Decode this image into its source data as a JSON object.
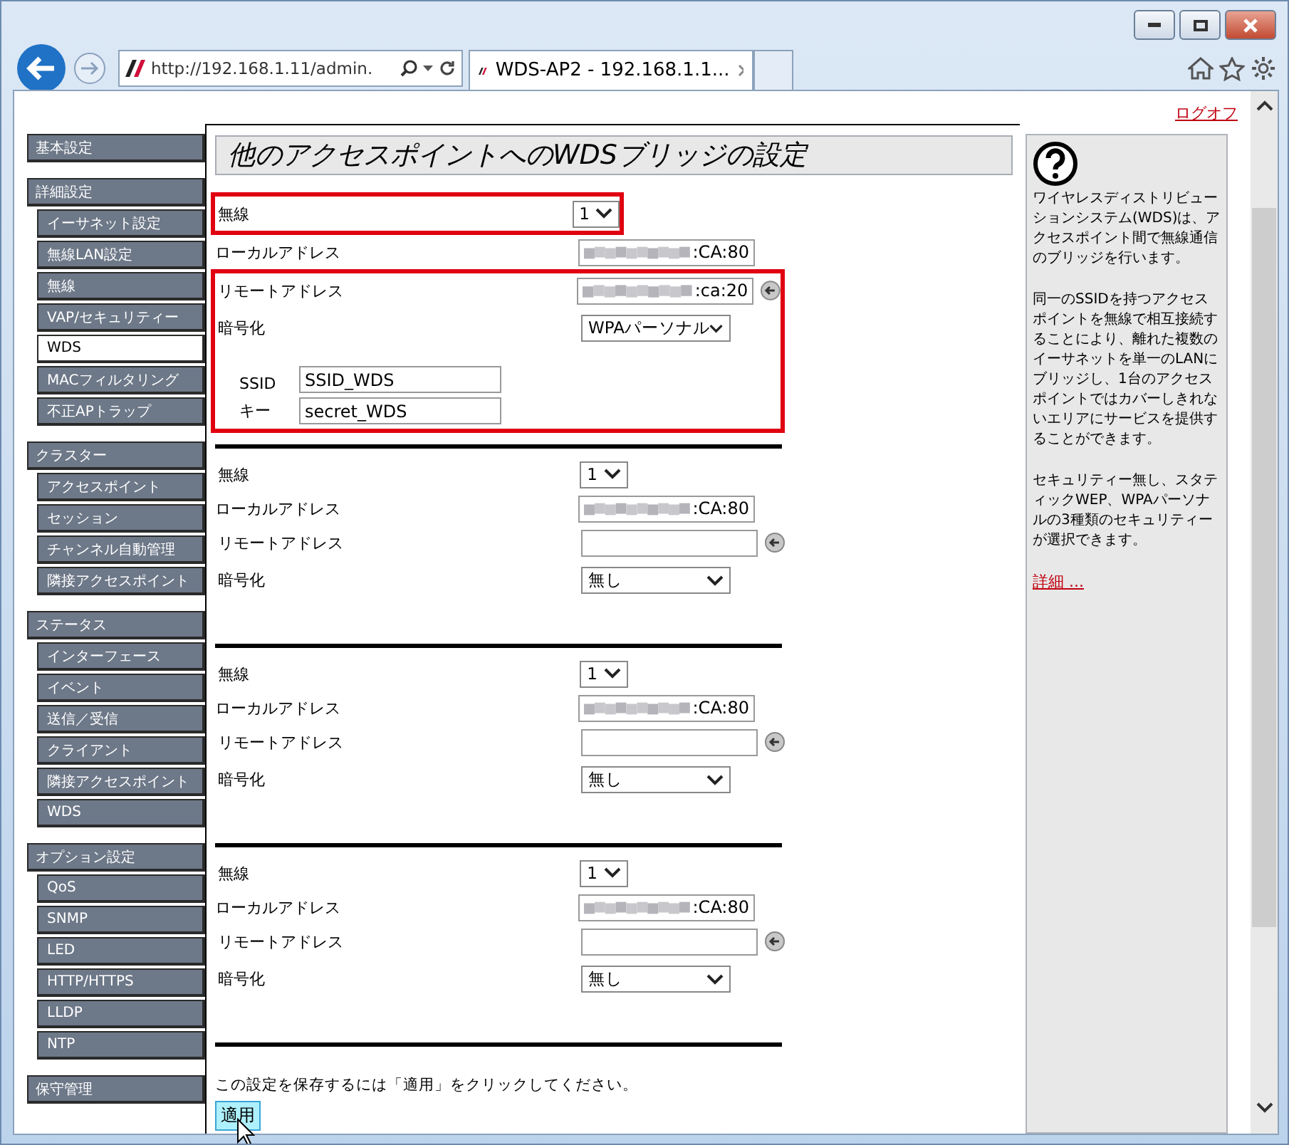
{
  "browser": {
    "address": "http://192.168.1.11/admin.",
    "tab_title": "WDS-AP2 - 192.168.1.1..."
  },
  "logoff": "ログオフ",
  "sidebar": {
    "groups": [
      {
        "label": "基本設定"
      },
      {
        "label": "詳細設定",
        "children": [
          {
            "label": "イーサネット設定",
            "selected": false
          },
          {
            "label": "無線LAN設定",
            "selected": false
          },
          {
            "label": "無線",
            "selected": false
          },
          {
            "label": "VAP/セキュリティー",
            "selected": false
          },
          {
            "label": "WDS",
            "selected": true
          },
          {
            "label": "MACフィルタリング",
            "selected": false
          },
          {
            "label": "不正APトラップ",
            "selected": false
          }
        ]
      },
      {
        "label": "クラスター",
        "children": [
          {
            "label": "アクセスポイント",
            "selected": false
          },
          {
            "label": "セッション",
            "selected": false
          },
          {
            "label": "チャンネル自動管理",
            "selected": false
          },
          {
            "label": "隣接アクセスポイント",
            "selected": false
          }
        ]
      },
      {
        "label": "ステータス",
        "children": [
          {
            "label": "インターフェース",
            "selected": false
          },
          {
            "label": "イベント",
            "selected": false
          },
          {
            "label": "送信／受信",
            "selected": false
          },
          {
            "label": "クライアント",
            "selected": false
          },
          {
            "label": "隣接アクセスポイント",
            "selected": false
          },
          {
            "label": "WDS",
            "selected": false
          }
        ]
      },
      {
        "label": "オプション設定",
        "children": [
          {
            "label": "QoS",
            "selected": false
          },
          {
            "label": "SNMP",
            "selected": false
          },
          {
            "label": "LED",
            "selected": false
          },
          {
            "label": "HTTP/HTTPS",
            "selected": false
          },
          {
            "label": "LLDP",
            "selected": false
          },
          {
            "label": "NTP",
            "selected": false
          }
        ]
      },
      {
        "label": "保守管理"
      }
    ]
  },
  "page_title": "他のアクセスポイントへのWDSブリッジの設定",
  "bridges": [
    {
      "highlighted": true,
      "wireless": {
        "label": "無線",
        "value": "1"
      },
      "local": {
        "label": "ローカルアドレス",
        "value": ":CA:80",
        "masked": true
      },
      "remote": {
        "label": "リモートアドレス",
        "value": ":ca:20",
        "masked": true
      },
      "encryption": {
        "label": "暗号化",
        "value": "WPAパーソナル"
      },
      "ssid": {
        "label": "SSID",
        "value": "SSID_WDS"
      },
      "key": {
        "label": "キー",
        "value": "secret_WDS"
      }
    },
    {
      "highlighted": false,
      "wireless": {
        "label": "無線",
        "value": "1"
      },
      "local": {
        "label": "ローカルアドレス",
        "value": ":CA:80",
        "masked": true
      },
      "remote": {
        "label": "リモートアドレス"
      },
      "encryption": {
        "label": "暗号化",
        "value": "無し"
      }
    },
    {
      "highlighted": false,
      "wireless": {
        "label": "無線",
        "value": "1"
      },
      "local": {
        "label": "ローカルアドレス",
        "value": ":CA:80",
        "masked": true
      },
      "remote": {
        "label": "リモートアドレス"
      },
      "encryption": {
        "label": "暗号化",
        "value": "無し"
      }
    },
    {
      "highlighted": false,
      "wireless": {
        "label": "無線",
        "value": "1"
      },
      "local": {
        "label": "ローカルアドレス",
        "value": ":CA:80",
        "masked": true
      },
      "remote": {
        "label": "リモートアドレス"
      },
      "encryption": {
        "label": "暗号化",
        "value": "無し"
      }
    }
  ],
  "save_hint": "この設定を保存するには「適用」をクリックしてください。",
  "apply_button": "適用",
  "help": {
    "paragraphs": [
      "ワイヤレスディストリビューションシステム(WDS)は、アクセスポイント間で無線通信のブリッジを行います。",
      "同一のSSIDを持つアクセスポイントを無線で相互接続することにより、離れた複数のイーサネットを単一のLANにブリッジし、1台のアクセスポイントではカバーしきれないエリアにサービスを提供することができます。",
      "セキュリティー無し、スタティックWEP、WPAパーソナルの3種類のセキュリティーが選択できます。"
    ],
    "link": "詳細 ..."
  }
}
